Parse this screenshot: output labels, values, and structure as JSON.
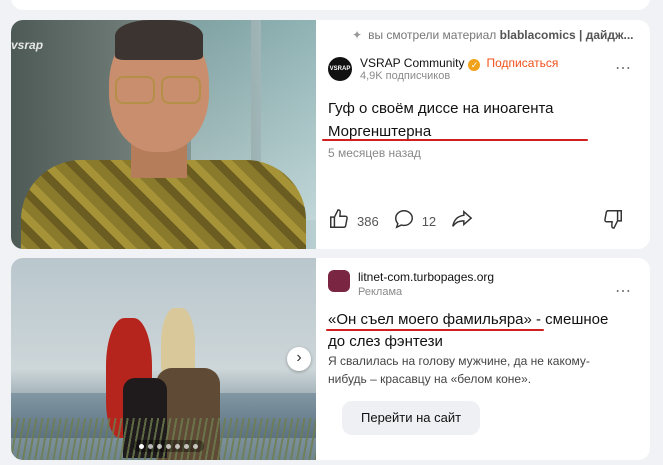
{
  "card1": {
    "photo_logo": "vsrap",
    "viewed_prefix": "вы смотрели материал",
    "viewed_source": "blablacomics | дайдж...",
    "channel_avatar_text": "VSRAP",
    "channel_name": "VSRAP Community",
    "subscribe_label": "Подписаться",
    "subscribers": "4,9K подписчиков",
    "title": "Гуф о своём диссе на иноагента Моргенштерна",
    "date": "5 месяцев назад",
    "likes": "386",
    "comments": "12",
    "more_icon": "⋯"
  },
  "card2": {
    "domain": "litnet-com.turbopages.org",
    "ad_label": "Реклама",
    "title_highlight": "«Он съел моего фамильяра»",
    "title_rest": " - смешное до слез фэнтези",
    "description": "Я свалилась на голову мужчине, да не какому-нибудь – красавцу на «белом коне».",
    "cta_label": "Перейти на сайт",
    "next_icon": "›",
    "carousel_dots": 7,
    "active_dot": 1,
    "more_icon": "⋯"
  },
  "colors": {
    "accent": "#f0501a",
    "underline": "#d0201f",
    "verified": "#f0a21b"
  }
}
